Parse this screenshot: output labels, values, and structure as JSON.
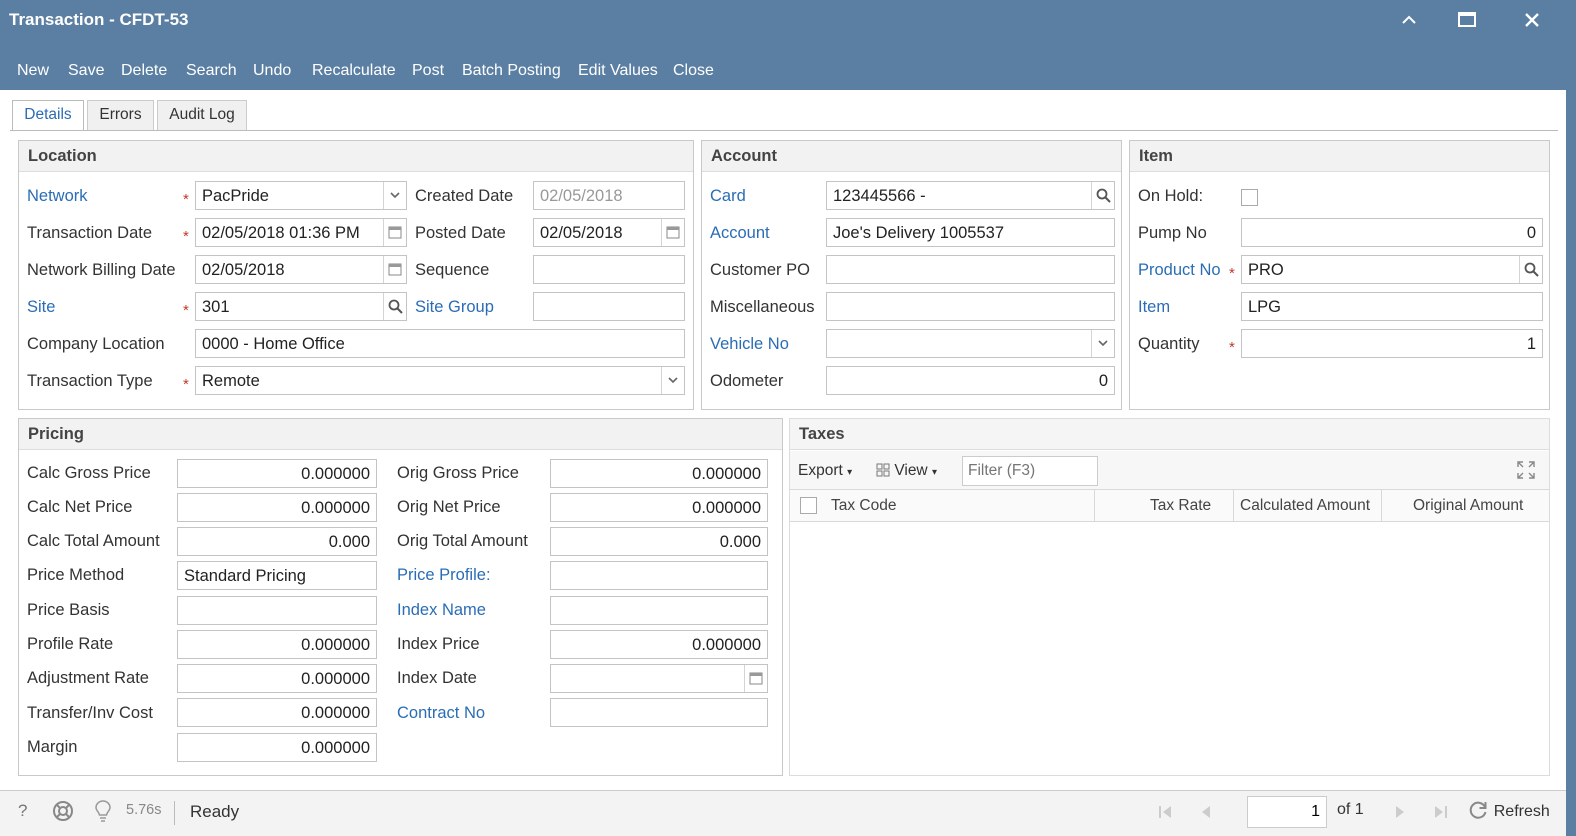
{
  "window": {
    "title": "Transaction - CFDT-53"
  },
  "toolbar": {
    "new": "New",
    "save": "Save",
    "delete": "Delete",
    "search": "Search",
    "undo": "Undo",
    "recalculate": "Recalculate",
    "post": "Post",
    "batch_posting": "Batch Posting",
    "edit_values": "Edit Values",
    "close": "Close"
  },
  "tabs": {
    "details": "Details",
    "errors": "Errors",
    "audit_log": "Audit Log"
  },
  "location": {
    "header": "Location",
    "network_label": "Network",
    "network_value": "PacPride",
    "transaction_date_label": "Transaction Date",
    "transaction_date_value": "02/05/2018 01:36 PM",
    "network_billing_date_label": "Network Billing Date",
    "network_billing_date_value": "02/05/2018",
    "site_label": "Site",
    "site_value": "301",
    "company_location_label": "Company Location",
    "company_location_value": "0000 - Home Office",
    "transaction_type_label": "Transaction Type",
    "transaction_type_value": "Remote",
    "created_date_label": "Created Date",
    "created_date_value": "02/05/2018",
    "posted_date_label": "Posted Date",
    "posted_date_value": "02/05/2018",
    "sequence_label": "Sequence",
    "sequence_value": "",
    "site_group_label": "Site Group",
    "site_group_value": ""
  },
  "account": {
    "header": "Account",
    "card_label": "Card",
    "card_value": "123445566 -",
    "account_label": "Account",
    "account_value": "Joe's Delivery 1005537",
    "customer_po_label": "Customer PO",
    "customer_po_value": "",
    "miscellaneous_label": "Miscellaneous",
    "miscellaneous_value": "",
    "vehicle_no_label": "Vehicle No",
    "vehicle_no_value": "",
    "odometer_label": "Odometer",
    "odometer_value": "0"
  },
  "item": {
    "header": "Item",
    "on_hold_label": "On Hold:",
    "on_hold_checked": false,
    "pump_no_label": "Pump No",
    "pump_no_value": "0",
    "product_no_label": "Product No",
    "product_no_value": "PRO",
    "item_label": "Item",
    "item_value": "LPG",
    "quantity_label": "Quantity",
    "quantity_value": "1"
  },
  "pricing": {
    "header": "Pricing",
    "calc_gross_price_label": "Calc Gross Price",
    "calc_gross_price_value": "0.000000",
    "calc_net_price_label": "Calc Net Price",
    "calc_net_price_value": "0.000000",
    "calc_total_amount_label": "Calc Total Amount",
    "calc_total_amount_value": "0.000",
    "price_method_label": "Price Method",
    "price_method_value": "Standard Pricing",
    "price_basis_label": "Price Basis",
    "price_basis_value": "",
    "profile_rate_label": "Profile Rate",
    "profile_rate_value": "0.000000",
    "adjustment_rate_label": "Adjustment Rate",
    "adjustment_rate_value": "0.000000",
    "transfer_inv_cost_label": "Transfer/Inv Cost",
    "transfer_inv_cost_value": "0.000000",
    "margin_label": "Margin",
    "margin_value": "0.000000",
    "orig_gross_price_label": "Orig Gross Price",
    "orig_gross_price_value": "0.000000",
    "orig_net_price_label": "Orig Net Price",
    "orig_net_price_value": "0.000000",
    "orig_total_amount_label": "Orig Total Amount",
    "orig_total_amount_value": "0.000",
    "price_profile_label": "Price Profile:",
    "price_profile_value": "",
    "index_name_label": "Index Name",
    "index_name_value": "",
    "index_price_label": "Index Price",
    "index_price_value": "0.000000",
    "index_date_label": "Index Date",
    "index_date_value": "",
    "contract_no_label": "Contract No",
    "contract_no_value": ""
  },
  "taxes": {
    "header": "Taxes",
    "export_label": "Export",
    "view_label": "View",
    "filter_placeholder": "Filter (F3)",
    "columns": [
      "Tax Code",
      "Tax Rate",
      "Calculated Amount",
      "Original Amount"
    ],
    "rows": []
  },
  "status": {
    "timing": "5.76s",
    "state": "Ready",
    "page": "1",
    "of_pages": "of 1",
    "refresh": "Refresh"
  },
  "colors": {
    "frame": "#5b7fa3",
    "link": "#2a6db5",
    "required": "#c0392b"
  },
  "icons": [
    "restore-icon",
    "maximize-icon",
    "close-icon",
    "dropdown-icon",
    "calendar-icon",
    "search-icon",
    "grid-icon",
    "expand-icon",
    "help-icon",
    "support-icon",
    "lightbulb-icon",
    "first-page-icon",
    "prev-page-icon",
    "next-page-icon",
    "last-page-icon",
    "refresh-icon"
  ]
}
